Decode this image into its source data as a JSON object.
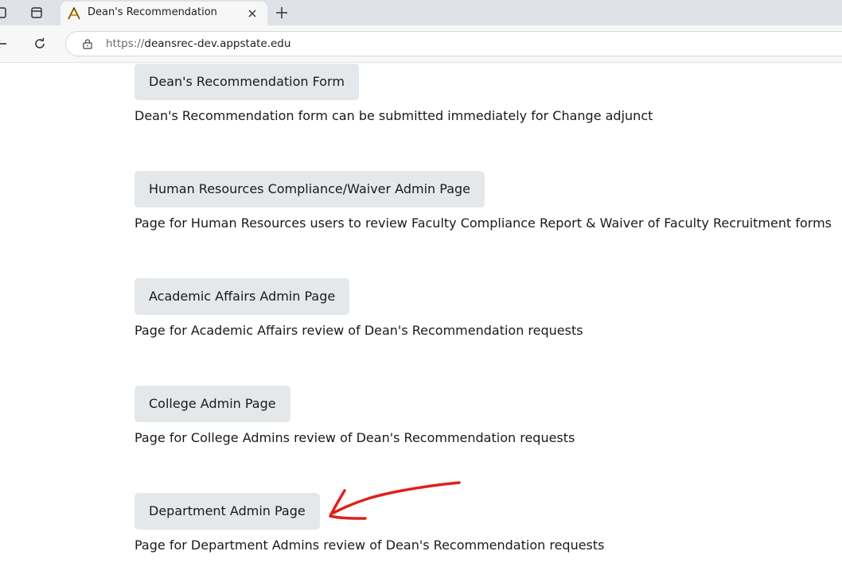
{
  "browser": {
    "tab_title": "Dean's Recommendation",
    "url_scheme": "https://",
    "url_host": "deansrec-dev.appstate.edu",
    "favicon_color": "#c9a227"
  },
  "sections": [
    {
      "button_label": "Dean's Recommendation Form",
      "description": "Dean's Recommendation form can be submitted immediately for Change adjunct"
    },
    {
      "button_label": "Human Resources Compliance/Waiver Admin Page",
      "description": "Page for Human Resources users to review Faculty Compliance Report & Waiver of Faculty Recruitment forms"
    },
    {
      "button_label": "Academic Affairs Admin Page",
      "description": "Page for Academic Affairs review of Dean's Recommendation requests"
    },
    {
      "button_label": "College Admin Page",
      "description": "Page for College Admins review of Dean's Recommendation requests"
    },
    {
      "button_label": "Department Admin Page",
      "description": "Page for Department Admins review of Dean's Recommendation requests"
    }
  ],
  "annotation": {
    "color": "#e0201b",
    "icon": "red-hand-drawn-arrow"
  }
}
